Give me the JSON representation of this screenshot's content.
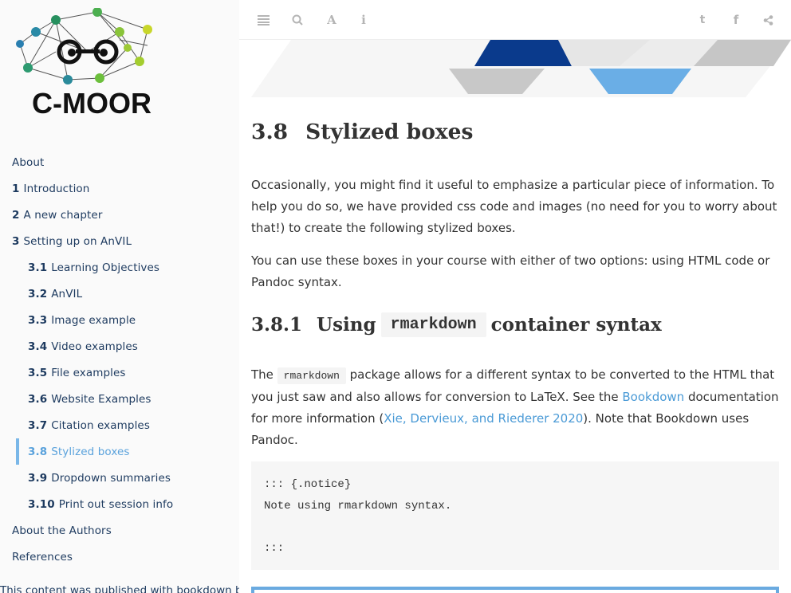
{
  "logo": {
    "text": "C-MOOR"
  },
  "toc": [
    {
      "num": "",
      "label": "About",
      "level": 1
    },
    {
      "num": "1",
      "label": "Introduction",
      "level": 1
    },
    {
      "num": "2",
      "label": "A new chapter",
      "level": 1
    },
    {
      "num": "3",
      "label": "Setting up on AnVIL",
      "level": 1
    },
    {
      "num": "3.1",
      "label": "Learning Objectives",
      "level": 2
    },
    {
      "num": "3.2",
      "label": "AnVIL",
      "level": 2
    },
    {
      "num": "3.3",
      "label": "Image example",
      "level": 2
    },
    {
      "num": "3.4",
      "label": "Video examples",
      "level": 2
    },
    {
      "num": "3.5",
      "label": "File examples",
      "level": 2
    },
    {
      "num": "3.6",
      "label": "Website Examples",
      "level": 2
    },
    {
      "num": "3.7",
      "label": "Citation examples",
      "level": 2
    },
    {
      "num": "3.8",
      "label": "Stylized boxes",
      "level": 2,
      "active": true
    },
    {
      "num": "3.9",
      "label": "Dropdown summaries",
      "level": 2
    },
    {
      "num": "3.10",
      "label": "Print out session info",
      "level": 2
    },
    {
      "num": "",
      "label": "About the Authors",
      "level": 1
    },
    {
      "num": "",
      "label": "References",
      "level": 1
    }
  ],
  "published": "This content was published with bookdown by:",
  "toolbar": {
    "toggle": "☰",
    "search": "⌕",
    "font": "A",
    "info": "i",
    "twitter": "t",
    "facebook": "f",
    "share": "<"
  },
  "section": {
    "num": "3.8",
    "title": "Stylized boxes"
  },
  "para1": "Occasionally, you might find it useful to emphasize a particular piece of information. To help you do so, we have provided css code and images (no need for you to worry about that!) to create the following stylized boxes.",
  "para2": "You can use these boxes in your course with either of two options: using HTML code or Pandoc syntax.",
  "subsection": {
    "num": "3.8.1",
    "before": "Using",
    "code": "rmarkdown",
    "after": "container syntax"
  },
  "para3": {
    "t1": "The ",
    "code": "rmarkdown",
    "t2": " package allows for a different syntax to be converted to the HTML that you just saw and also allows for conversion to LaTeX. See the ",
    "link1": "Bookdown",
    "t3": " documentation for more information (",
    "link2": "Xie, Dervieux, and Riederer 2020",
    "t4": "). Note that Bookdown uses Pandoc."
  },
  "codeblock": "::: {.notice}\nNote using rmarkdown syntax.\n\n:::",
  "colors": {
    "accent": "#5aa2dc",
    "nav": "#1d3a5f",
    "banner_dark": "#0a3a8c",
    "banner_light": "#6aaee6"
  }
}
